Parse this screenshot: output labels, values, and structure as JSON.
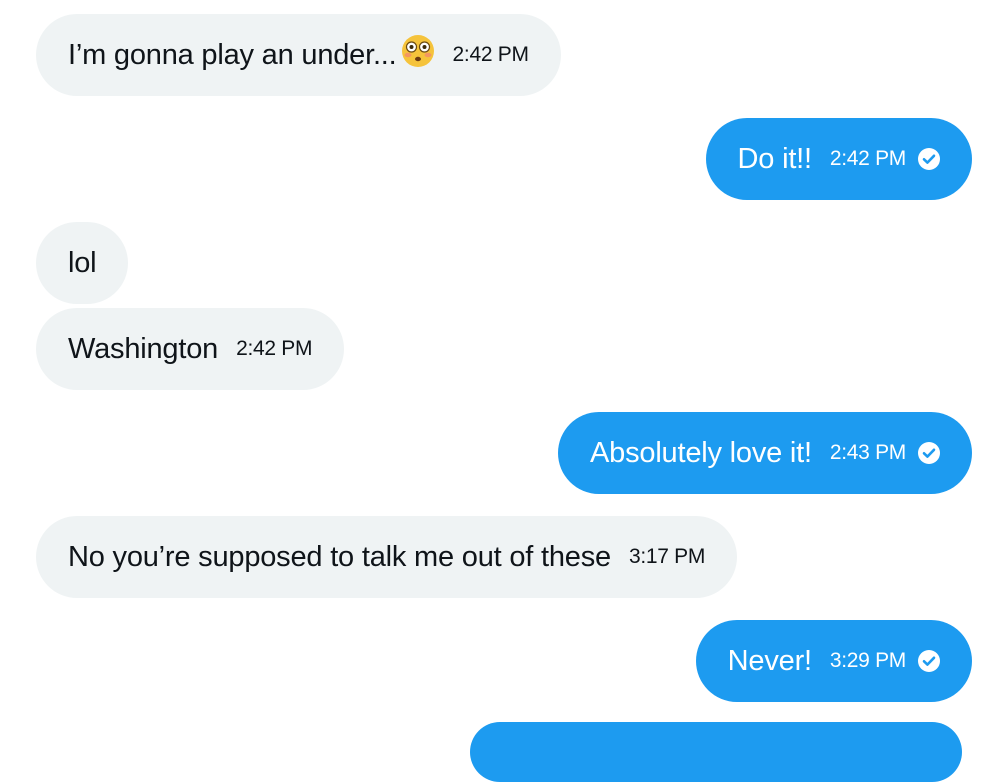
{
  "messages": [
    {
      "text": "I’m gonna play an under...",
      "time": "2:42 PM",
      "emoji": "flushed-face"
    },
    {
      "text": "Do it!!",
      "time": "2:42 PM",
      "status": "read-check"
    },
    {
      "text": "lol"
    },
    {
      "text": "Washington",
      "time": "2:42 PM"
    },
    {
      "text": "Absolutely love it!",
      "time": "2:43 PM",
      "status": "read-check"
    },
    {
      "text": "No you’re supposed to talk me out of these",
      "time": "3:17 PM"
    },
    {
      "text": "Never!",
      "time": "3:29 PM",
      "status": "read-check"
    }
  ],
  "colors": {
    "incoming_bubble": "#eff3f4",
    "outgoing_bubble": "#1d9bf0",
    "incoming_text": "#0f1419",
    "outgoing_text": "#ffffff"
  }
}
